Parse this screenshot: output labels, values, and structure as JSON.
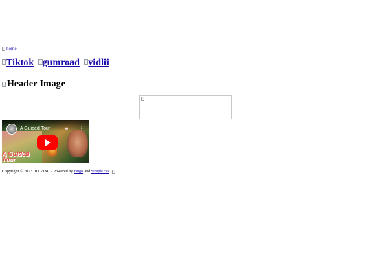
{
  "nav": {
    "home_alt": "home"
  },
  "social": [
    {
      "alt": "Tiktok"
    },
    {
      "alt": "gumroad"
    },
    {
      "alt": "vidlii"
    }
  ],
  "header": {
    "image_alt": "Header Image"
  },
  "video": {
    "title": "A Guided Tour",
    "overlay_text_1": "A Guided",
    "overlay_text_2": "Tour"
  },
  "footer": {
    "copyright": "Copyright © 2023 IIITVINC - Powered by",
    "hugo_link": "Hugo",
    "and": "and",
    "simplecss_link": "Simple.css",
    "period": "."
  }
}
